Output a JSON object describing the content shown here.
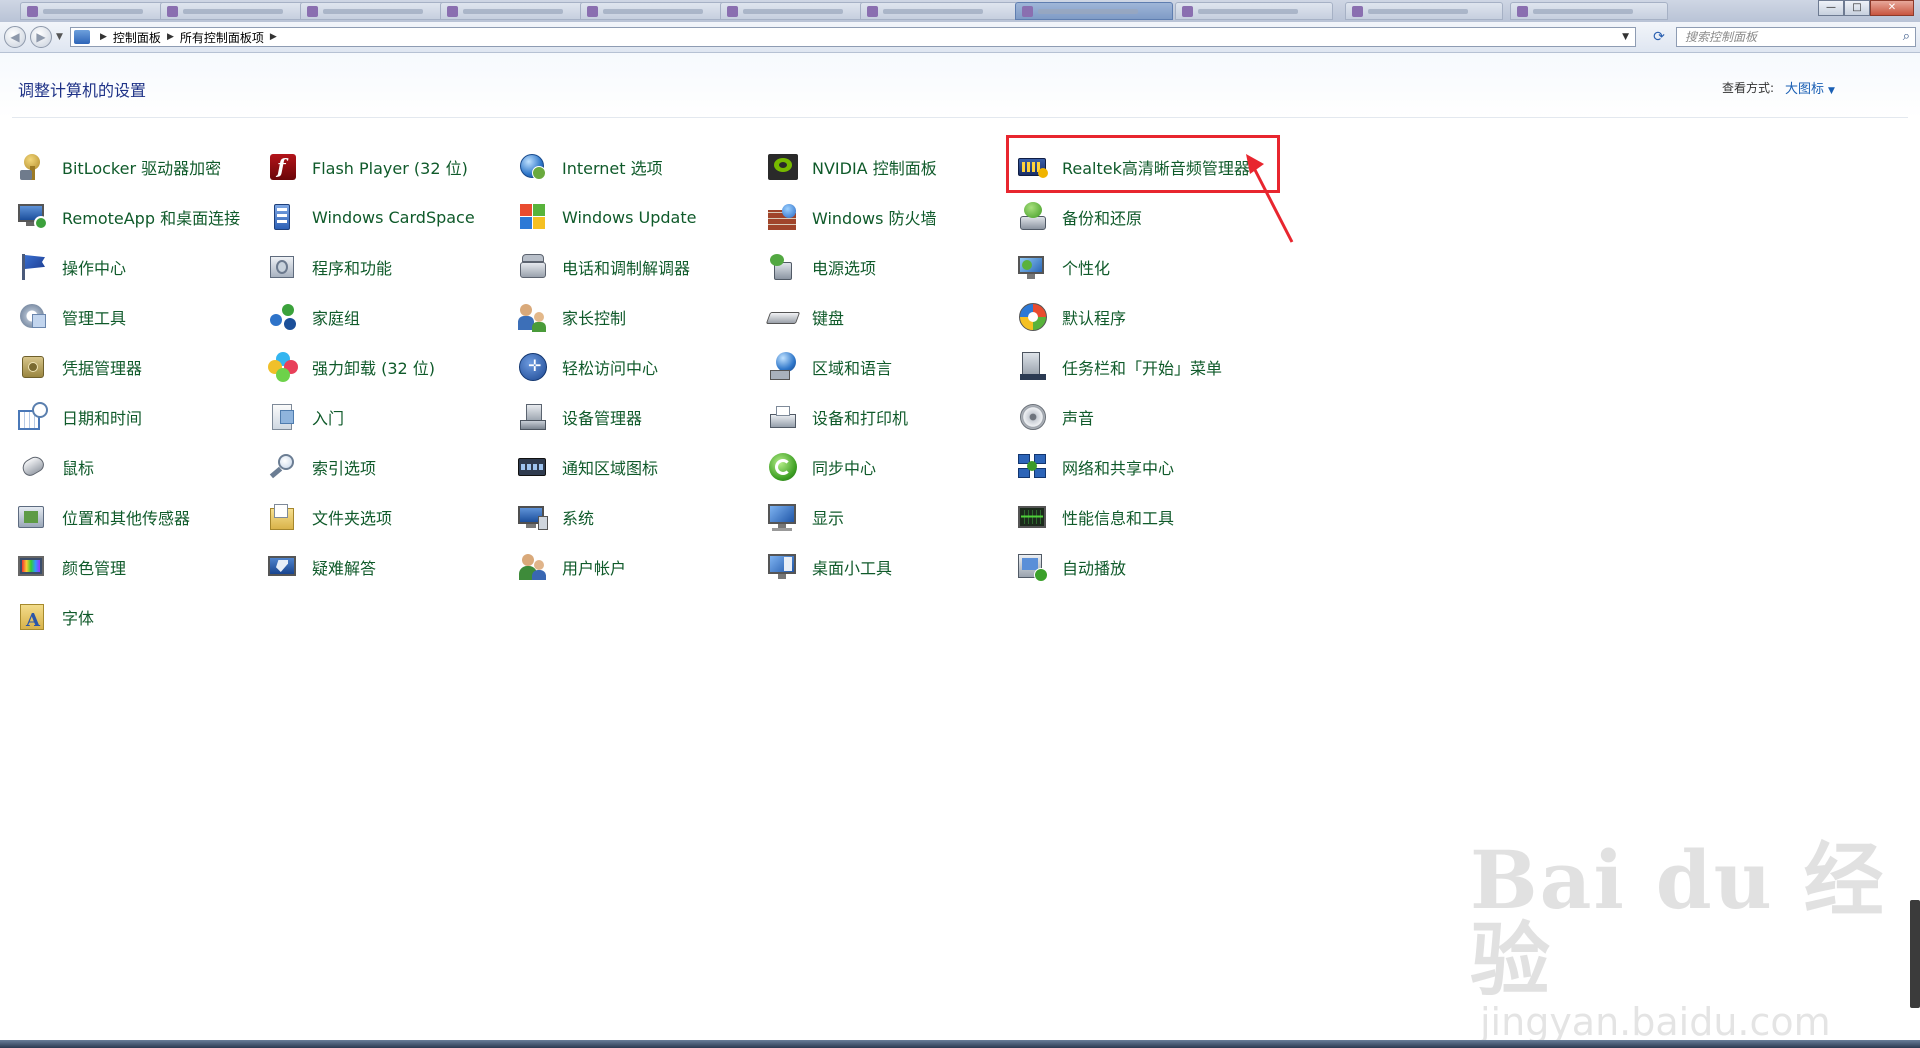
{
  "window": {
    "breadcrumb": [
      "控制面板",
      "所有控制面板项"
    ],
    "search_placeholder": "搜索控制面板",
    "buttons": {
      "minimize": "—",
      "maximize": "□",
      "close": "✕"
    }
  },
  "header": {
    "title": "调整计算机的设置",
    "view_by_label": "查看方式:",
    "view_by_value": "大图标"
  },
  "items": [
    {
      "label": "BitLocker 驱动器加密",
      "icon": "bitlocker-key-icon"
    },
    {
      "label": "RemoteApp 和桌面连接",
      "icon": "remoteapp-icon"
    },
    {
      "label": "操作中心",
      "icon": "action-center-flag-icon"
    },
    {
      "label": "管理工具",
      "icon": "admin-tools-icon"
    },
    {
      "label": "凭据管理器",
      "icon": "credential-safe-icon"
    },
    {
      "label": "日期和时间",
      "icon": "calendar-clock-icon"
    },
    {
      "label": "鼠标",
      "icon": "mouse-icon"
    },
    {
      "label": "位置和其他传感器",
      "icon": "sensor-icon"
    },
    {
      "label": "颜色管理",
      "icon": "color-management-icon"
    },
    {
      "label": "字体",
      "icon": "font-folder-icon"
    },
    {
      "label": "Flash Player (32 位)",
      "icon": "flash-player-icon"
    },
    {
      "label": "Windows CardSpace",
      "icon": "cardspace-icon"
    },
    {
      "label": "程序和功能",
      "icon": "programs-icon"
    },
    {
      "label": "家庭组",
      "icon": "homegroup-icon"
    },
    {
      "label": "强力卸载 (32 位)",
      "icon": "uninstaller-icon"
    },
    {
      "label": "入门",
      "icon": "getting-started-icon"
    },
    {
      "label": "索引选项",
      "icon": "indexing-icon"
    },
    {
      "label": "文件夹选项",
      "icon": "folder-options-icon"
    },
    {
      "label": "疑难解答",
      "icon": "troubleshoot-icon"
    },
    {
      "label": "Internet 选项",
      "icon": "internet-globe-icon"
    },
    {
      "label": "Windows Update",
      "icon": "windows-update-icon"
    },
    {
      "label": "电话和调制解调器",
      "icon": "phone-modem-icon"
    },
    {
      "label": "家长控制",
      "icon": "parental-controls-icon"
    },
    {
      "label": "轻松访问中心",
      "icon": "ease-of-access-icon"
    },
    {
      "label": "设备管理器",
      "icon": "device-manager-icon"
    },
    {
      "label": "通知区域图标",
      "icon": "notification-area-icon"
    },
    {
      "label": "系统",
      "icon": "system-icon"
    },
    {
      "label": "用户帐户",
      "icon": "user-accounts-icon"
    },
    {
      "label": "NVIDIA 控制面板",
      "icon": "nvidia-icon"
    },
    {
      "label": "Windows 防火墙",
      "icon": "firewall-icon"
    },
    {
      "label": "电源选项",
      "icon": "power-options-icon"
    },
    {
      "label": "键盘",
      "icon": "keyboard-icon"
    },
    {
      "label": "区域和语言",
      "icon": "region-language-icon"
    },
    {
      "label": "设备和打印机",
      "icon": "printer-icon"
    },
    {
      "label": "同步中心",
      "icon": "sync-center-icon"
    },
    {
      "label": "显示",
      "icon": "display-icon"
    },
    {
      "label": "桌面小工具",
      "icon": "gadgets-icon"
    },
    {
      "label": "Realtek高清晰音频管理器",
      "icon": "realtek-audio-icon"
    },
    {
      "label": "备份和还原",
      "icon": "backup-restore-icon"
    },
    {
      "label": "个性化",
      "icon": "personalization-icon"
    },
    {
      "label": "默认程序",
      "icon": "default-programs-icon"
    },
    {
      "label": "任务栏和「开始」菜单",
      "icon": "taskbar-start-icon"
    },
    {
      "label": "声音",
      "icon": "sound-speaker-icon"
    },
    {
      "label": "网络和共享中心",
      "icon": "network-icon"
    },
    {
      "label": "性能信息和工具",
      "icon": "performance-icon"
    },
    {
      "label": "自动播放",
      "icon": "autoplay-icon"
    }
  ],
  "watermark": {
    "line1": "Bai du 经验",
    "line2": "jingyan.baidu.com"
  }
}
